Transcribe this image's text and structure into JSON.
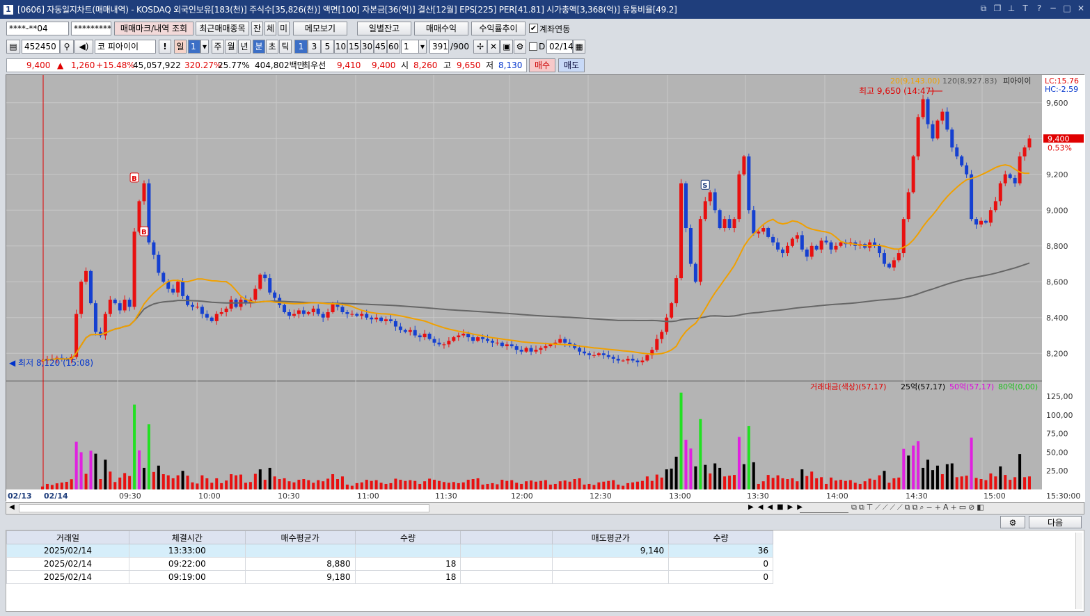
{
  "window": {
    "title": "[0606] 자동일지차트(매매내역) - KOSDAQ 외국인보유[183(천)] 주식수[35,826(천)] 액면[100] 자본금[36(억)] 결산[12월] EPS[225] PER[41.81] 시가총액[3,368(억)] 유통비율[49.2]",
    "number": "1"
  },
  "toolbar1": {
    "account": "****-**04",
    "password": "*********",
    "btn_mark": "매매마크/내역 조회",
    "btn_recent": "최근매매종목",
    "btn_jan": "잔",
    "btn_che": "체",
    "btn_mi": "미",
    "btn_memo": "메모보기",
    "btn_daily": "일별잔고",
    "btn_profit": "매매수익",
    "btn_rate": "수익률추이",
    "chk_link": "계좌연동"
  },
  "toolbar2": {
    "code": "452450",
    "market": "코",
    "name": "피아이이",
    "excl": "!",
    "period_day": "일",
    "period_num": "1",
    "week": "주",
    "month": "월",
    "year": "년",
    "minute": "분",
    "second": "초",
    "tick": "틱",
    "intervals": [
      "1",
      "3",
      "5",
      "10",
      "15",
      "30",
      "45",
      "60"
    ],
    "sel_interval": "1",
    "count_sel": "1",
    "count": "391",
    "count_max": "/900",
    "d_label": "D",
    "date": "02/14"
  },
  "quote": {
    "price": "9,400",
    "arrow": "▲",
    "change": "1,260",
    "pct": "+15.48%",
    "volume": "45,057,922",
    "vol_ratio": "320.27%",
    "turnover": "25.77%",
    "amount": "404,802백만",
    "best_label": "최우선",
    "ask": "9,410",
    "bid": "9,400",
    "open_label": "시",
    "open": "8,260",
    "high_label": "고",
    "high": "9,650",
    "low_label": "저",
    "low": "8,130",
    "buy": "매수",
    "sell": "매도"
  },
  "chart_data": {
    "type": "candlestick",
    "title": "피아이이",
    "ma_legend": [
      "20(9,143.00)",
      "120(8,927.83)"
    ],
    "lc": "LC:15.76",
    "hc": "HC:-2.59",
    "price_label": "9,400",
    "price_pct": "0.53%",
    "y_ticks": [
      "9,600",
      "9,400",
      "9,200",
      "9,000",
      "8,800",
      "8,600",
      "8,400",
      "8,200"
    ],
    "ylim": [
      8100,
      9700
    ],
    "high_note": "최고 9,650 (14:47)",
    "low_note": "최저 8,120 (15:08)",
    "x_ticks": [
      "02/13",
      "02/14",
      "09:30",
      "10:00",
      "10:30",
      "11:00",
      "11:30",
      "12:00",
      "12:30",
      "13:00",
      "13:30",
      "14:00",
      "14:30",
      "15:00",
      "15:30:00"
    ],
    "trade_marks": [
      {
        "type": "B",
        "time": "09:19",
        "price": 9180
      },
      {
        "type": "B",
        "time": "09:22",
        "price": 8880
      },
      {
        "type": "S",
        "time": "13:33",
        "price": 9140
      }
    ],
    "volume_legend": {
      "main": "거래대금(색상)(57,17)",
      "s25": "25억(57,17)",
      "s50": "50억(57,17)",
      "s80": "80억(0,00)"
    },
    "vol_ticks": [
      "125,00",
      "100,00",
      "75,00",
      "50,00",
      "25,00"
    ],
    "close_series": [
      8160,
      8170,
      8170,
      8175,
      8170,
      8165,
      8180,
      8420,
      8600,
      8660,
      8480,
      8320,
      8300,
      8420,
      8500,
      8480,
      8440,
      8500,
      8460,
      8880,
      9050,
      9150,
      8820,
      8750,
      8650,
      8600,
      8560,
      8540,
      8600,
      8520,
      8470,
      8460,
      8460,
      8420,
      8400,
      8380,
      8420,
      8430,
      8450,
      8500,
      8460,
      8500,
      8480,
      8500,
      8560,
      8640,
      8620,
      8540,
      8510,
      8470,
      8430,
      8410,
      8420,
      8440,
      8420,
      8430,
      8450,
      8420,
      8400,
      8430,
      8480,
      8460,
      8430,
      8420,
      8420,
      8410,
      8420,
      8400,
      8390,
      8400,
      8380,
      8390,
      8380,
      8350,
      8330,
      8320,
      8330,
      8300,
      8290,
      8310,
      8280,
      8260,
      8250,
      8250,
      8270,
      8290,
      8300,
      8310,
      8290,
      8270,
      8290,
      8280,
      8270,
      8260,
      8260,
      8240,
      8250,
      8240,
      8220,
      8210,
      8230,
      8210,
      8220,
      8230,
      8240,
      8250,
      8260,
      8280,
      8260,
      8250,
      8230,
      8210,
      8200,
      8190,
      8190,
      8200,
      8190,
      8180,
      8170,
      8160,
      8160,
      8170,
      8160,
      8150,
      8160,
      8190,
      8220,
      8280,
      8320,
      8400,
      8480,
      8620,
      9150,
      8900,
      8700,
      8600,
      8950,
      9050,
      9100,
      9000,
      8900,
      8950,
      8900,
      8950,
      9200,
      9300,
      9000,
      8870,
      8880,
      8900,
      8850,
      8820,
      8780,
      8760,
      8800,
      8840,
      8860,
      8780,
      8740,
      8800,
      8780,
      8830,
      8820,
      8780,
      8800,
      8820,
      8810,
      8820,
      8800,
      8810,
      8790,
      8820,
      8800,
      8760,
      8700,
      8680,
      8720,
      8760,
      8950,
      9100,
      9300,
      9520,
      9620,
      9480,
      9400,
      9500,
      9550,
      9450,
      9350,
      9300,
      9250,
      9200,
      8950,
      8920,
      8940,
      8930,
      9000,
      9050,
      9150,
      9200,
      9180,
      9150,
      9300,
      9350,
      9400
    ]
  },
  "scroll": {
    "next": "다음"
  },
  "table": {
    "headers": [
      "거래일",
      "체결시간",
      "매수평균가",
      "수량",
      "",
      "매도평균가",
      "수량"
    ],
    "rows": [
      [
        "2025/02/14",
        "13:33:00",
        "",
        "",
        "",
        "9,140",
        "36"
      ],
      [
        "2025/02/14",
        "09:22:00",
        "8,880",
        "18",
        "",
        "",
        "0"
      ],
      [
        "2025/02/14",
        "09:19:00",
        "9,180",
        "18",
        "",
        "",
        "0"
      ]
    ]
  }
}
